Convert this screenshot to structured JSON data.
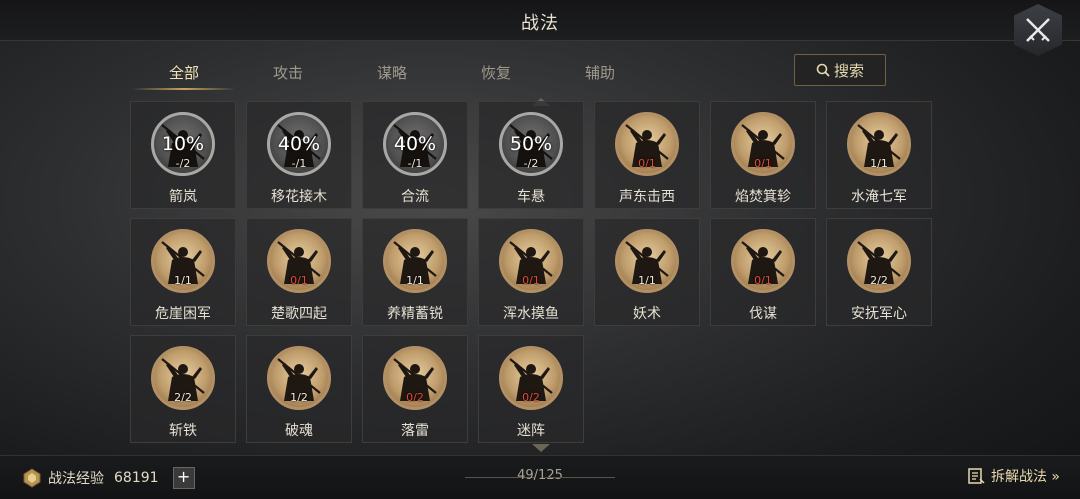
{
  "header": {
    "title": "战法",
    "close_icon": "crossed-swords-icon"
  },
  "tabs": [
    {
      "label": "全部",
      "active": true
    },
    {
      "label": "攻击",
      "active": false
    },
    {
      "label": "谋略",
      "active": false
    },
    {
      "label": "恢复",
      "active": false
    },
    {
      "label": "辅助",
      "active": false
    }
  ],
  "search": {
    "label": "搜索",
    "icon": "search-icon"
  },
  "skills": [
    {
      "name": "箭岚",
      "count": "-/2",
      "cooldown": "10%"
    },
    {
      "name": "移花接木",
      "count": "-/1",
      "cooldown": "40%"
    },
    {
      "name": "合流",
      "count": "-/1",
      "cooldown": "40%"
    },
    {
      "name": "车悬",
      "count": "-/2",
      "cooldown": "50%"
    },
    {
      "name": "声东击西",
      "count": "0/1"
    },
    {
      "name": "焰焚箕轸",
      "count": "0/1"
    },
    {
      "name": "水淹七军",
      "count": "1/1"
    },
    {
      "name": "危崖困军",
      "count": "1/1"
    },
    {
      "name": "楚歌四起",
      "count": "0/1"
    },
    {
      "name": "养精蓄锐",
      "count": "1/1"
    },
    {
      "name": "浑水摸鱼",
      "count": "0/1"
    },
    {
      "name": "妖术",
      "count": "1/1"
    },
    {
      "name": "伐谋",
      "count": "0/1"
    },
    {
      "name": "安抚军心",
      "count": "2/2"
    },
    {
      "name": "斩铁",
      "count": "2/2"
    },
    {
      "name": "破魂",
      "count": "1/2"
    },
    {
      "name": "落雷",
      "count": "0/2"
    },
    {
      "name": "迷阵",
      "count": "0/2"
    }
  ],
  "footer": {
    "exp_label": "战法经验",
    "exp_value": "68191",
    "plus": "+",
    "page": "49/125",
    "decompose_label": "拆解战法 »"
  },
  "colors": {
    "accent": "#c9a45c",
    "count_red": "#e04a3c",
    "text": "#e6e0d2"
  }
}
